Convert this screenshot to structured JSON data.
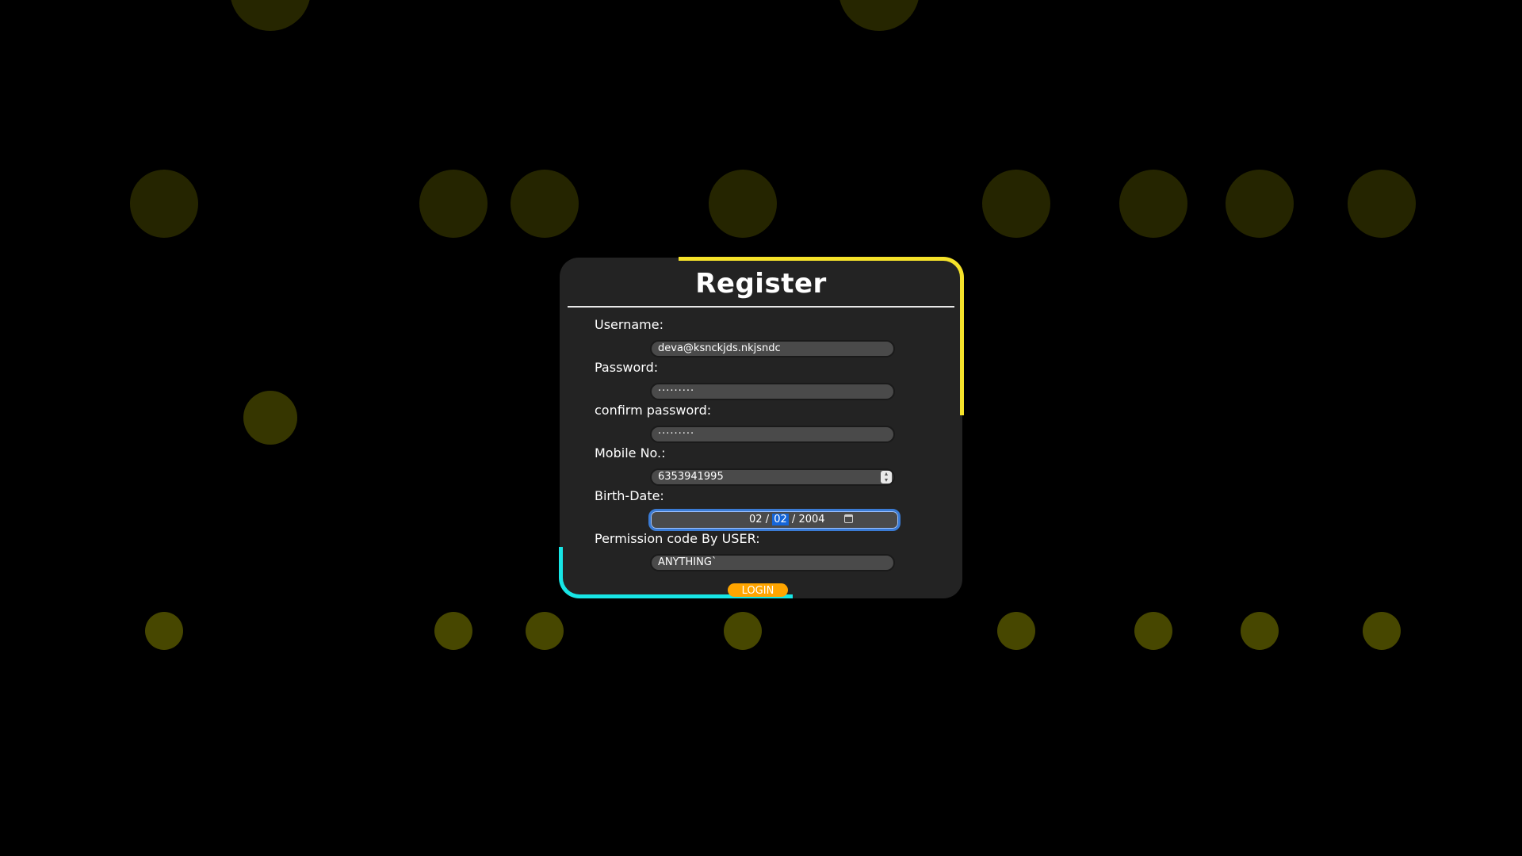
{
  "theme": {
    "background": "#000000",
    "card_background": "#232323",
    "accent_yellow": "#f5e22a",
    "accent_cyan": "#17e6e6",
    "button_color": "#ffa500",
    "focus_color": "#3a7bd5"
  },
  "form": {
    "title": "Register",
    "username": {
      "label": "Username:",
      "value": "deva@ksnckjds.nkjsndc"
    },
    "password": {
      "label": "Password:",
      "value": "·········"
    },
    "confirm_password": {
      "label": "confirm password:",
      "value": "·········"
    },
    "mobile": {
      "label": "Mobile No.:",
      "value": "6353941995"
    },
    "birth_date": {
      "label": "Birth-Date:",
      "month": "02",
      "day": "02",
      "year": "2004",
      "sep": "/"
    },
    "permission": {
      "label": "Permission code By USER:",
      "value": "ANYTHING`"
    },
    "submit_label": "LOGIN"
  }
}
